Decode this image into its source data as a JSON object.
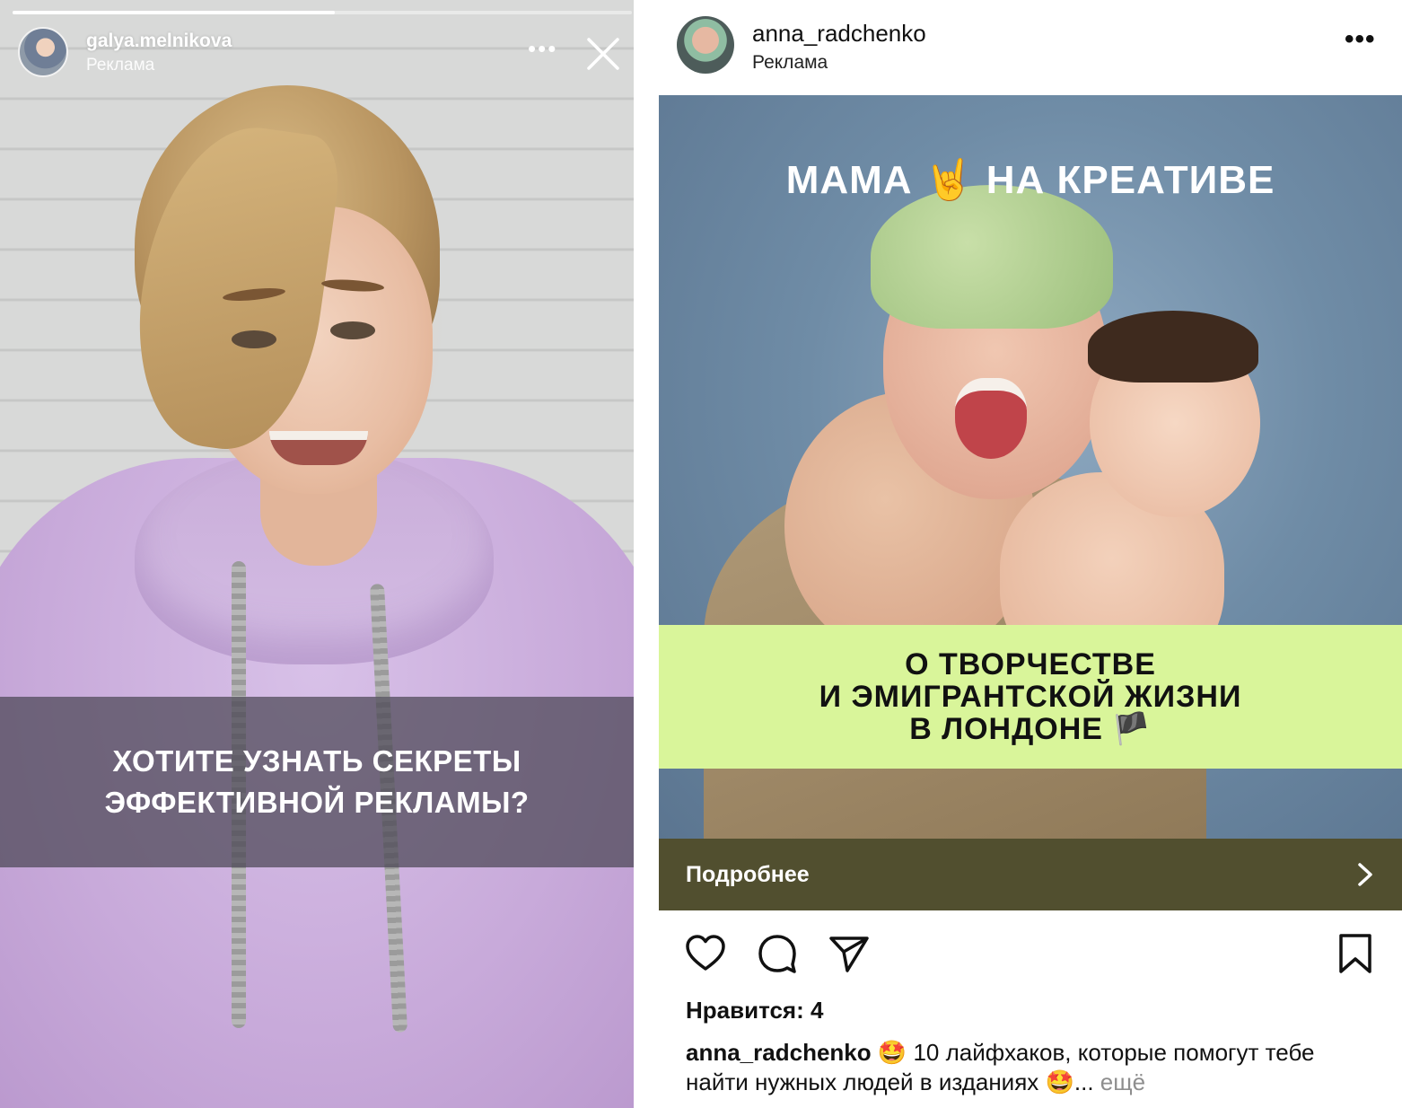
{
  "story": {
    "username": "galya.melnikova",
    "sponsored": "Реклама",
    "more_label": "•••",
    "progress": 0.52,
    "overlay_lines": [
      "ХОТИТЕ УЗНАТЬ СЕКРЕТЫ",
      "ЭФФЕКТИВНОЙ РЕКЛАМЫ?"
    ],
    "icons": {
      "close": "close-icon",
      "more": "more-horizontal-icon"
    }
  },
  "post": {
    "username": "anna_radchenko",
    "sponsored": "Реклама",
    "more_label": "•••",
    "image_title": "МАМА 🤘 НА КРЕАТИВЕ",
    "image_band_lines": [
      "О ТВОРЧЕСТВЕ",
      "И ЭМИГРАНТСКОЙ ЖИЗНИ",
      "В ЛОНДОНЕ 🏴"
    ],
    "cta_label": "Подробнее",
    "likes": "Нравится: 4",
    "caption_user": "anna_radchenko",
    "caption_text": " 🤩 10 лайфхаков, которые помогут тебе найти нужных людей в изданиях 🤩...",
    "caption_more": " ещё",
    "icons": {
      "like": "heart-icon",
      "comment": "comment-icon",
      "share": "send-icon",
      "save": "bookmark-icon",
      "cta": "chevron-right-icon"
    }
  },
  "colors": {
    "band": "#d9f59a",
    "cta_bar": "#514f2f",
    "story_overlay": "#4b4655"
  }
}
